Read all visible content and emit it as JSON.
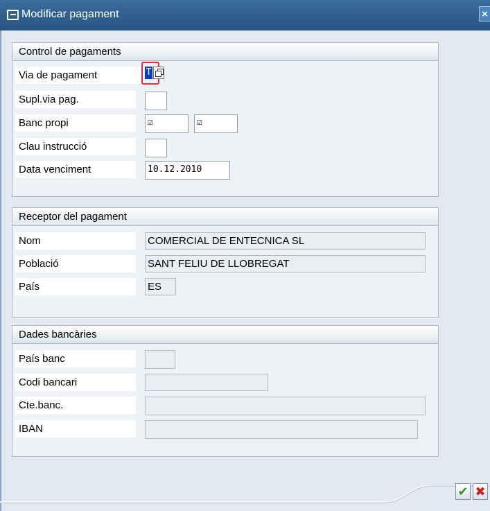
{
  "window": {
    "title": "Modificar pagament",
    "close_label": "×"
  },
  "control": {
    "heading": "Control de pagaments",
    "via_label": "Via de pagament",
    "via_value": "T",
    "supl_label": "Supl.via pag.",
    "supl_value": "",
    "banc_label": "Banc propi",
    "banc_value1": "☑",
    "banc_value2": "☑",
    "clau_label": "Clau instrucció",
    "clau_value": "",
    "data_label": "Data venciment",
    "data_value": "10.12.2010"
  },
  "receptor": {
    "heading": "Receptor del pagament",
    "nom_label": "Nom",
    "nom_value": "COMERCIAL DE ENTECNICA SL",
    "poblacio_label": "Població",
    "poblacio_value": "SANT FELIU DE LLOBREGAT",
    "pais_label": "País",
    "pais_value": "ES"
  },
  "bancaries": {
    "heading": "Dades bancàries",
    "pais_banc_label": "País banc",
    "pais_banc_value": "",
    "codi_label": "Codi bancari",
    "codi_value": "",
    "cte_label": "Cte.banc.",
    "cte_value": "",
    "iban_label": "IBAN",
    "iban_value": ""
  },
  "buttons": {
    "ok_symbol": "✔",
    "cancel_symbol": "✖"
  },
  "colors": {
    "title_bar": "#2f5d8c",
    "ok_green": "#2f9a1c",
    "cancel_red": "#c81e1e",
    "focus_red": "#e0303a"
  }
}
